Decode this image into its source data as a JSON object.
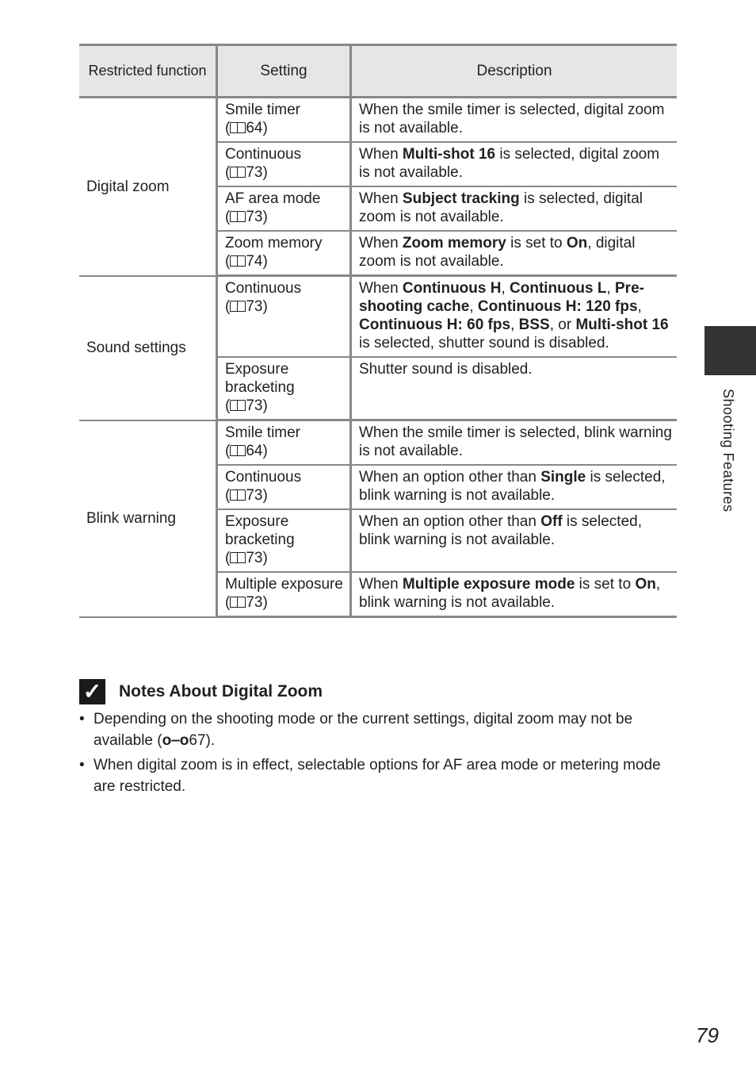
{
  "table": {
    "headers": [
      "Restricted function",
      "Setting",
      "Description"
    ],
    "groups": [
      {
        "function": "Digital zoom",
        "rows": [
          {
            "setting": "Smile timer",
            "ref": "64",
            "desc_html": "When the smile timer is selected, digital zoom is not available."
          },
          {
            "setting": "Continuous",
            "ref": "73",
            "desc_html": "When <b>Multi-shot 16</b> is selected, digital zoom is not available."
          },
          {
            "setting": "AF area mode",
            "ref": "73",
            "desc_html": "When <b>Subject tracking</b> is selected, digital zoom is not available."
          },
          {
            "setting": "Zoom memory",
            "ref": "74",
            "desc_html": "When <b>Zoom memory</b> is set to <b>On</b>, digital zoom is not available."
          }
        ]
      },
      {
        "function": "Sound settings",
        "rows": [
          {
            "setting": "Continuous",
            "ref": "73",
            "desc_html": "When <b>Continuous H</b>, <b>Continuous L</b>, <b>Pre-shooting cache</b>, <b>Continuous H: 120 fps</b>, <b>Continuous H: 60 fps</b>, <b>BSS</b>, or <b>Multi-shot 16</b> is selected, shutter sound is disabled."
          },
          {
            "setting": "Exposure bracketing",
            "ref": "73",
            "desc_html": "Shutter sound is disabled."
          }
        ]
      },
      {
        "function": "Blink warning",
        "rows": [
          {
            "setting": "Smile timer",
            "ref": "64",
            "desc_html": "When the smile timer is selected, blink warning is not available."
          },
          {
            "setting": "Continuous",
            "ref": "73",
            "desc_html": "When an option other than <b>Single</b> is selected, blink warning is not available."
          },
          {
            "setting": "Exposure bracketing",
            "ref": "73",
            "desc_html": "When an option other than <b>Off</b> is selected, blink warning is not available."
          },
          {
            "setting": "Multiple exposure",
            "ref": "73",
            "desc_html": "When <b>Multiple exposure mode</b> is set to <b>On</b>, blink warning is not available."
          }
        ]
      }
    ]
  },
  "notes": {
    "icon": "check-icon",
    "title": "Notes About Digital Zoom",
    "bullets": [
      {
        "text": "Depending on the shooting mode or the current settings, digital zoom may not be available (",
        "ref_icon": "binoculars-icon",
        "ref": "67",
        "tail": ")."
      },
      {
        "text": "When digital zoom is in effect, selectable options for AF area mode or metering mode are restricted."
      }
    ]
  },
  "side_tab": "Shooting Features",
  "page_number": "79"
}
